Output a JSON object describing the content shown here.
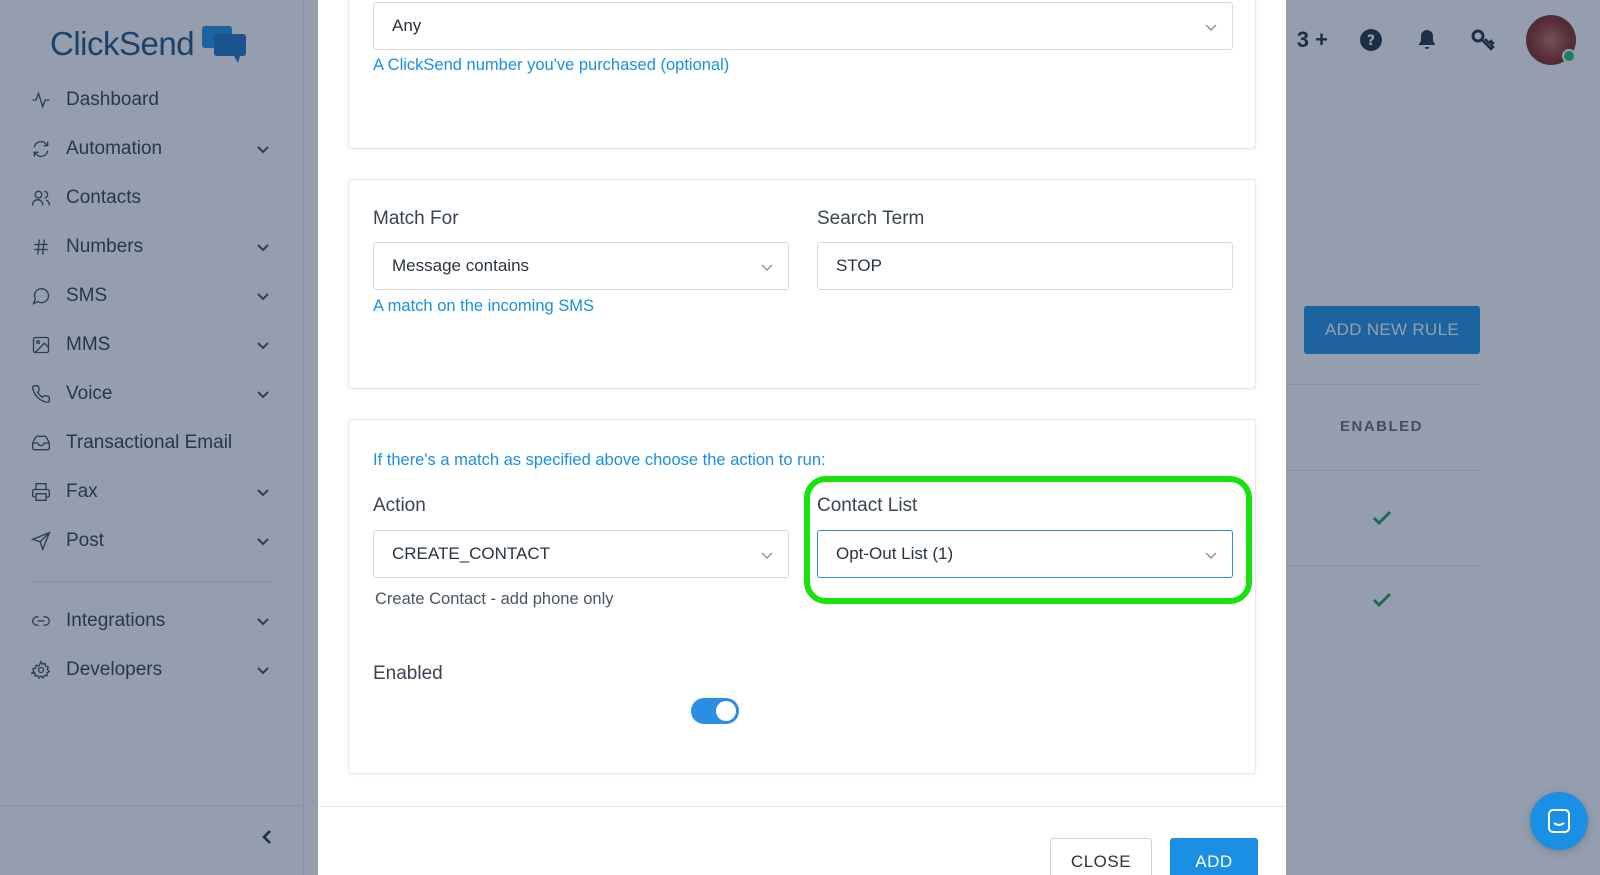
{
  "app": {
    "logo_text": "ClickSend"
  },
  "sidebar": {
    "items": [
      {
        "label": "Dashboard",
        "icon": "activity-icon",
        "has_children": false
      },
      {
        "label": "Automation",
        "icon": "refresh-icon",
        "has_children": true
      },
      {
        "label": "Contacts",
        "icon": "users-icon",
        "has_children": false
      },
      {
        "label": "Numbers",
        "icon": "hash-icon",
        "has_children": true
      },
      {
        "label": "SMS",
        "icon": "message-circle-icon",
        "has_children": true
      },
      {
        "label": "MMS",
        "icon": "image-icon",
        "has_children": true
      },
      {
        "label": "Voice",
        "icon": "phone-icon",
        "has_children": true
      },
      {
        "label": "Transactional Email",
        "icon": "inbox-icon",
        "has_children": false
      },
      {
        "label": "Fax",
        "icon": "printer-icon",
        "has_children": true
      },
      {
        "label": "Post",
        "icon": "send-icon",
        "has_children": true
      }
    ],
    "secondary_items": [
      {
        "label": "Integrations",
        "icon": "link-icon",
        "has_children": true
      },
      {
        "label": "Developers",
        "icon": "settings-icon",
        "has_children": true
      }
    ]
  },
  "topbar": {
    "credit_fragment": "3"
  },
  "background": {
    "add_new_rule_label": "ADD NEW RULE",
    "enabled_header": "ENABLED"
  },
  "modal": {
    "dedicated_number": {
      "value": "Any",
      "hint": "A ClickSend number you've purchased (optional)"
    },
    "match": {
      "match_for_label": "Match For",
      "match_for_value": "Message contains",
      "match_for_hint": "A match on the incoming SMS",
      "search_term_label": "Search Term",
      "search_term_value": "STOP"
    },
    "action": {
      "intro": "If there's a match as specified above choose the action to run:",
      "action_label": "Action",
      "action_value": "CREATE_CONTACT",
      "action_hint": "Create Contact - add phone only",
      "contact_list_label": "Contact List",
      "contact_list_value": "Opt-Out List (1)",
      "enabled_label": "Enabled",
      "enabled": true
    },
    "footer": {
      "close_label": "CLOSE",
      "add_label": "ADD"
    }
  },
  "colors": {
    "accent": "#1a8fe3",
    "highlight": "#17e20e",
    "overlay": "#203456"
  }
}
